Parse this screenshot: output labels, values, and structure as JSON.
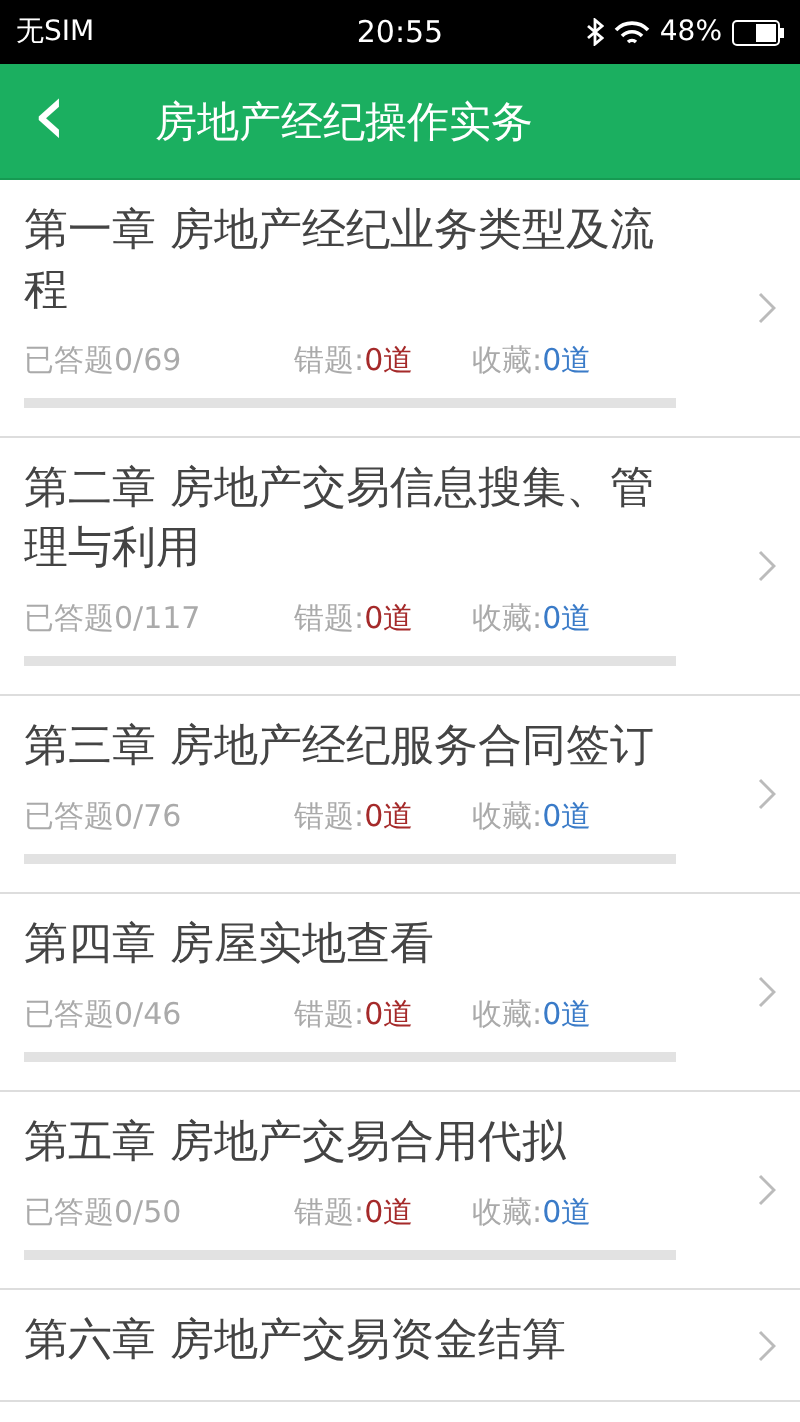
{
  "status_bar": {
    "carrier": "无SIM",
    "time": "20:55",
    "battery": "48%"
  },
  "header": {
    "back": "‹",
    "title": "房地产经纪操作实务"
  },
  "chapters": [
    {
      "title": "第一章 房地产经纪业务类型及流程",
      "answered": "已答题0/69",
      "wrong_label": "错题:",
      "wrong": "0道",
      "fav_label": "收藏:",
      "fav": "0道",
      "level": 0
    },
    {
      "title": "第二章 房地产交易信息搜集、管理与利用",
      "answered": "已答题0/117",
      "wrong_label": "错题:",
      "wrong": "0道",
      "fav_label": "收藏:",
      "fav": "0道",
      "level": 0
    },
    {
      "title": "第三章 房地产经纪服务合同签订",
      "answered": "已答题0/76",
      "wrong_label": "错题:",
      "wrong": "0道",
      "fav_label": "收藏:",
      "fav": "0道",
      "level": 0
    },
    {
      "title": "第四章 房屋实地查看",
      "answered": "已答题0/46",
      "wrong_label": "错题:",
      "wrong": "0道",
      "fav_label": "收藏:",
      "fav": "0道",
      "level": 0
    },
    {
      "title": "第五章 房地产交易合用代拟",
      "answered": "已答题0/50",
      "wrong_label": "错题:",
      "wrong": "0道",
      "fav_label": "收藏:",
      "fav": "0道",
      "level": 0
    },
    {
      "title": "第六章 房地产交易资金结算"
    }
  ]
}
